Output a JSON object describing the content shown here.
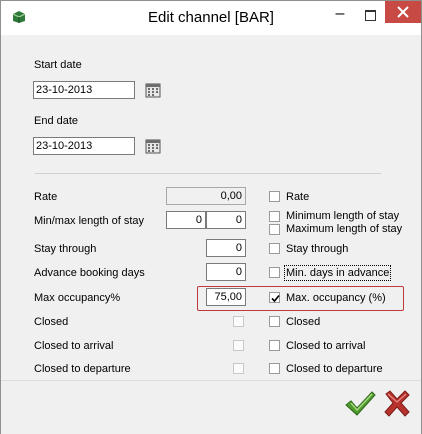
{
  "window": {
    "title": "Edit channel [BAR]",
    "minimize_glyph": "–",
    "icons": {
      "app": "channel-app-icon",
      "maximize": "maximize-icon",
      "close": "close-icon"
    }
  },
  "dates": {
    "start": {
      "label": "Start date",
      "value": "23-10-2013"
    },
    "end": {
      "label": "End date",
      "value": "23-10-2013"
    }
  },
  "rows": {
    "rate": {
      "label": "Rate",
      "value": "0,00",
      "option": "Rate",
      "checked": false
    },
    "minmax": {
      "label": "Min/max length of stay",
      "min": "0",
      "max": "0",
      "option_min": "Minimum length of stay",
      "option_max": "Maximum length of stay"
    },
    "stay_through": {
      "label": "Stay through",
      "value": "0",
      "option": "Stay through",
      "checked": false
    },
    "advance": {
      "label": "Advance booking days",
      "value": "0",
      "option": "Min. days in advance",
      "checked": false
    },
    "occupancy": {
      "label": "Max occupancy%",
      "value": "75,00",
      "option": "Max. occupancy (%)",
      "checked": true
    },
    "closed": {
      "label": "Closed",
      "option": "Closed",
      "checked": false
    },
    "cta": {
      "label": "Closed to arrival",
      "option": "Closed to arrival",
      "checked": false
    },
    "ctd": {
      "label": "Closed to departure",
      "option": "Closed to departure",
      "checked": false
    }
  },
  "colors": {
    "highlight": "#c0393b",
    "ok": "#4f9b2e",
    "cancel": "#b8322d",
    "close_button": "#c74a45"
  }
}
